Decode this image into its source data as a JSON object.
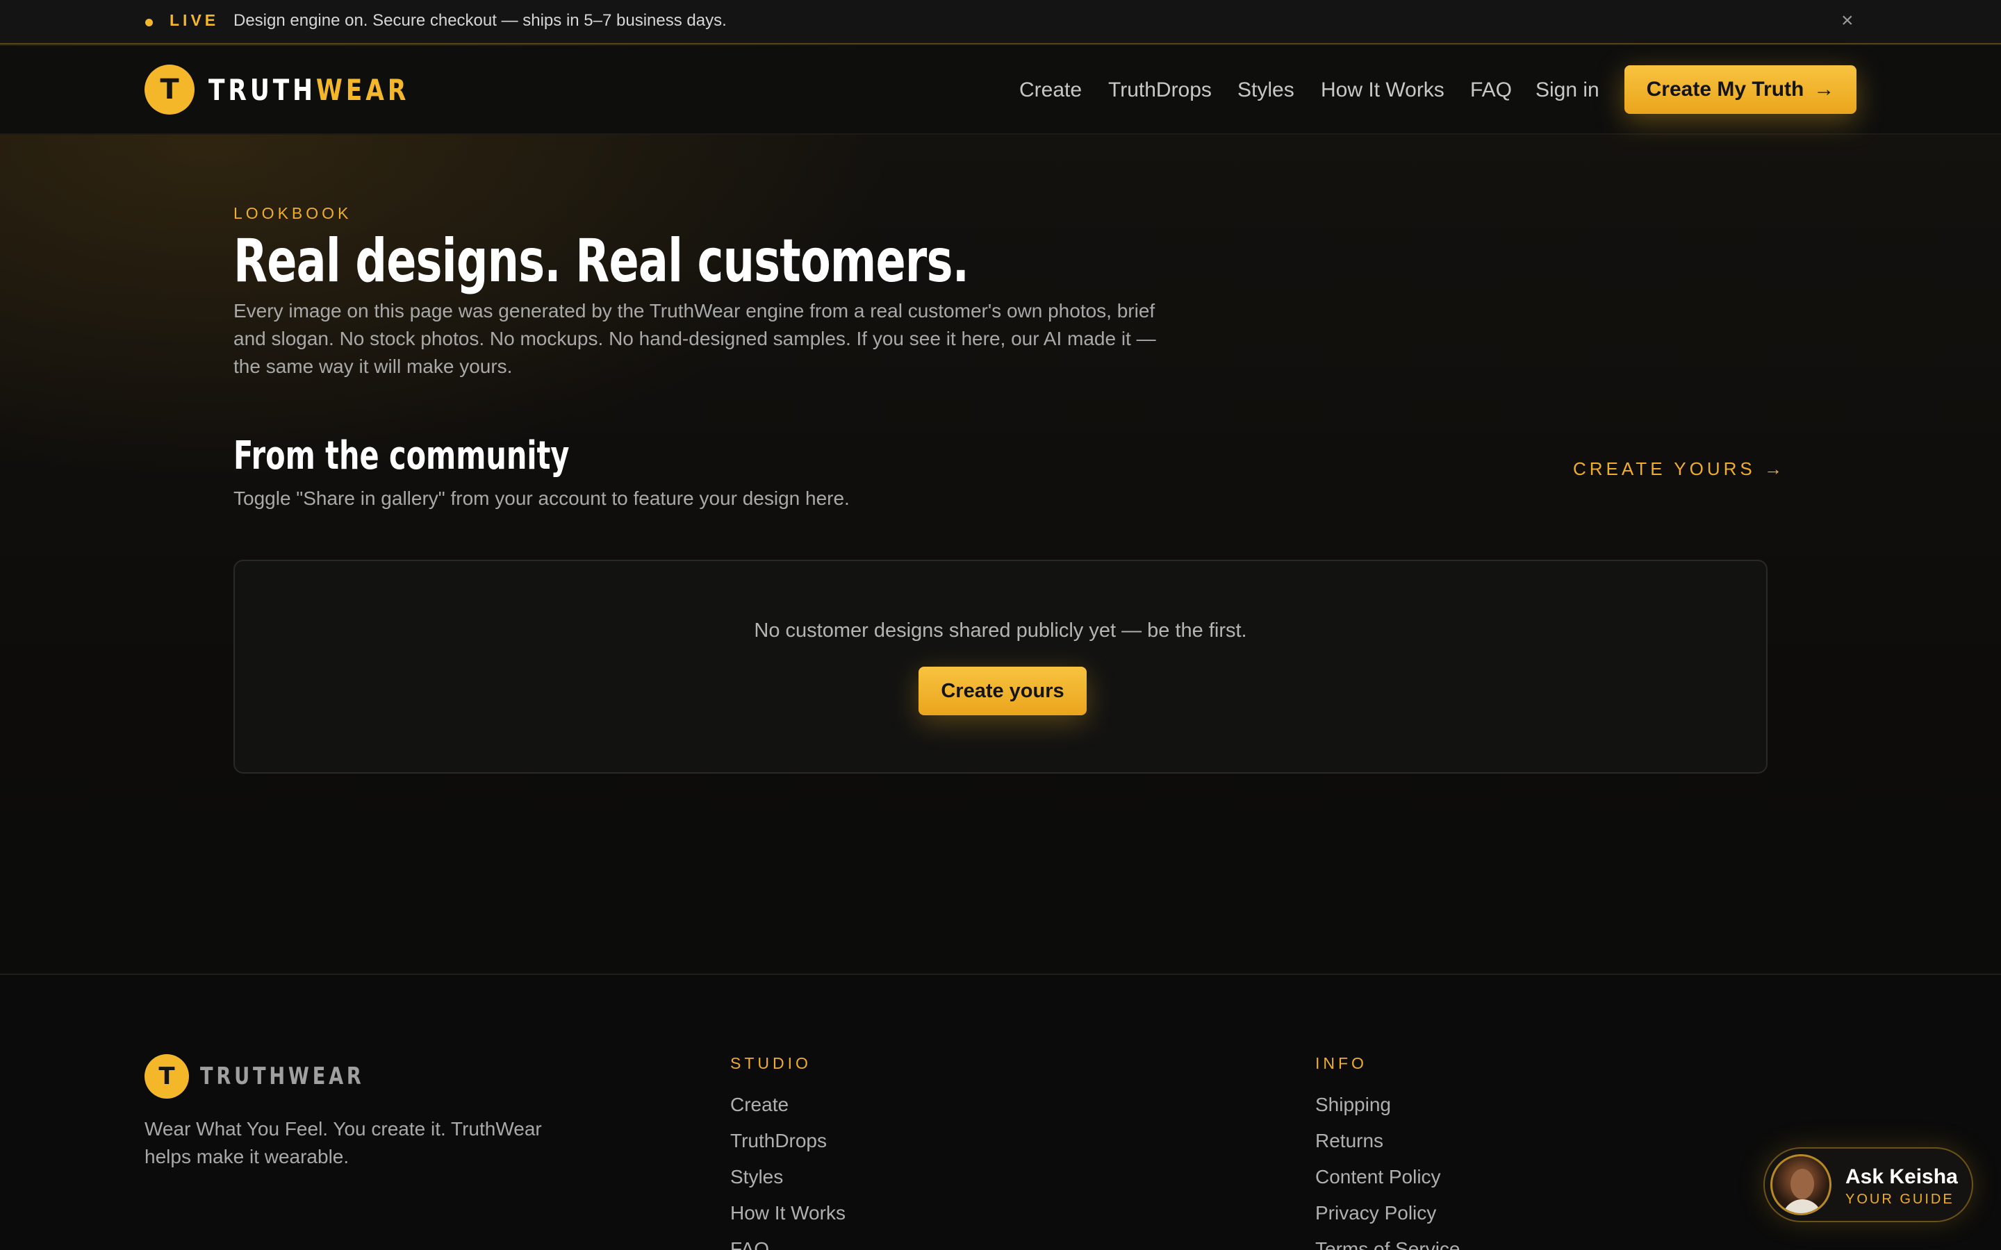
{
  "announcement": {
    "live_label": "LIVE",
    "message": "Design engine on. Secure checkout — ships in 5–7 business days.",
    "close_icon": "×"
  },
  "header": {
    "logo_letter": "T",
    "logo_word_a": "TRUTH",
    "logo_word_b": "WEAR",
    "nav": [
      "Create",
      "TruthDrops",
      "Styles",
      "How It Works",
      "FAQ",
      "Sign in"
    ],
    "cta_label": "Create My Truth",
    "cta_icon": "→"
  },
  "hero": {
    "eyebrow": "LOOKBOOK",
    "title": "Real designs. Real customers.",
    "description": "Every image on this page was generated by the TruthWear engine from a real customer's own photos, brief and slogan. No stock photos. No mockups. No hand-designed samples. If you see it here, our AI made it — the same way it will make yours."
  },
  "community": {
    "title": "From the community",
    "subtitle": "Toggle \"Share in gallery\" from your account to feature your design here.",
    "create_link": "CREATE YOURS →",
    "empty_message": "No customer designs shared publicly yet — be the first.",
    "empty_button": "Create yours"
  },
  "footer": {
    "logo_letter": "T",
    "logo_word": "TRUTHWEAR",
    "tagline": "Wear What You Feel. You create it. TruthWear helps make it wearable.",
    "studio": {
      "heading": "STUDIO",
      "links": [
        "Create",
        "TruthDrops",
        "Styles",
        "How It Works",
        "FAQ"
      ]
    },
    "info": {
      "heading": "INFO",
      "links": [
        "Shipping",
        "Returns",
        "Content Policy",
        "Privacy Policy",
        "Terms of Service"
      ]
    }
  },
  "chat": {
    "name": "Ask Keisha",
    "role": "YOUR GUIDE"
  },
  "colors": {
    "accent": "#f5b72a",
    "background": "#0c0b0a",
    "text_muted": "#a9a9a9"
  }
}
